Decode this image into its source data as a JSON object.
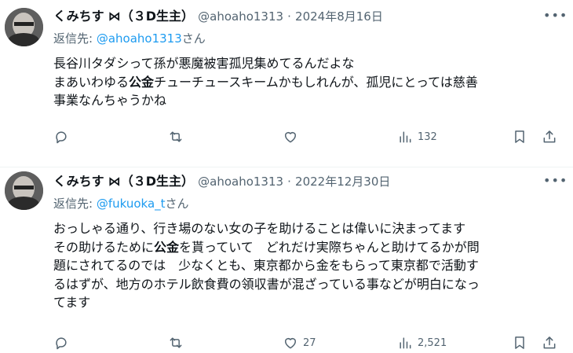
{
  "tweets": [
    {
      "author_name": "くみちす",
      "author_badge": "⋈（３D生主）",
      "handle": "@ahoaho1313",
      "dot": "·",
      "date": "2024年8月16日",
      "reply_prefix": "返信先: ",
      "reply_mention": "@ahoaho1313",
      "reply_suffix": "さん",
      "lines": [
        {
          "before": "長谷川タダシって孫が悪魔被害孤児集めてるんだよな",
          "bold": "",
          "after": ""
        },
        {
          "before": "まあいわゆる",
          "bold": "公金",
          "after": "チューチュースキームかもしれんが、孤児にとっては慈善"
        },
        {
          "before": "事業なんちゃうかね",
          "bold": "",
          "after": ""
        }
      ],
      "counts": {
        "reply": "",
        "retweet": "",
        "like": "",
        "views": "132"
      }
    },
    {
      "author_name": "くみちす",
      "author_badge": "⋈（３D生主）",
      "handle": "@ahoaho1313",
      "dot": "·",
      "date": "2022年12月30日",
      "reply_prefix": "返信先: ",
      "reply_mention": "@fukuoka_t",
      "reply_suffix": "さん",
      "lines": [
        {
          "before": "おっしゃる通り、行き場のない女の子を助けることは偉いに決まってます",
          "bold": "",
          "after": ""
        },
        {
          "before": "その助けるために",
          "bold": "公金",
          "after": "を貰っていて　どれだけ実際ちゃんと助けてるかが問"
        },
        {
          "before": "題にされてるのでは　少なくとも、東京都から金をもらって東京都で活動す",
          "bold": "",
          "after": ""
        },
        {
          "before": "るはずが、地方のホテル飲食費の領収書が混ざっている事などが明白になっ",
          "bold": "",
          "after": ""
        },
        {
          "before": "てます",
          "bold": "",
          "after": ""
        }
      ],
      "counts": {
        "reply": "",
        "retweet": "",
        "like": "27",
        "views": "2,521"
      }
    }
  ]
}
